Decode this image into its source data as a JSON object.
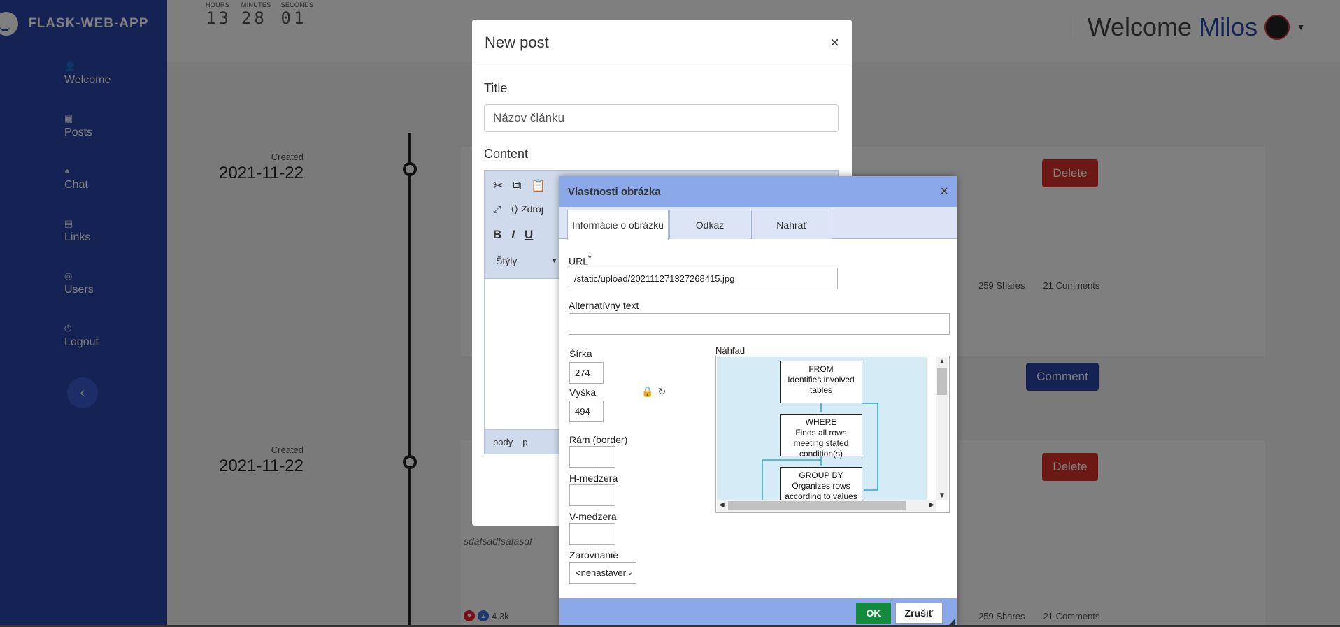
{
  "app": {
    "brand": "FLASK-WEB-APP"
  },
  "sidebar": {
    "items": [
      {
        "label": "Welcome",
        "icon": "user-icon"
      },
      {
        "label": "Posts",
        "icon": "posts-icon"
      },
      {
        "label": "Chat",
        "icon": "chat-icon"
      },
      {
        "label": "Links",
        "icon": "links-icon"
      },
      {
        "label": "Users",
        "icon": "users-icon"
      },
      {
        "label": "Logout",
        "icon": "logout-icon"
      }
    ]
  },
  "clock": {
    "hours_caption": "HOURS",
    "minutes_caption": "MINUTES",
    "seconds_caption": "SECONDS",
    "hours": "13",
    "minutes": "28",
    "seconds": "01"
  },
  "header": {
    "welcome": "Welcome",
    "user": "Milos"
  },
  "timeline": {
    "posts": [
      {
        "created_label": "Created",
        "date": "2021-11-22",
        "delete": "Delete",
        "shares": "259 Shares",
        "comments": "21 Comments",
        "comment_btn": "Comment"
      },
      {
        "created_label": "Created",
        "date": "2021-11-22",
        "delete": "Delete",
        "excerpt": "sdafsadfsafasdf",
        "likes": "4.3k",
        "shares": "259 Shares",
        "comments": "21 Comments"
      }
    ]
  },
  "new_post_modal": {
    "title": "New post",
    "title_label": "Title",
    "title_placeholder": "Názov článku",
    "content_label": "Content",
    "toolbar": {
      "source": "Zdroj",
      "bold": "B",
      "italic": "I",
      "underline": "U",
      "styles": "Štýly"
    },
    "path": {
      "body": "body",
      "p": "p"
    }
  },
  "image_dialog": {
    "title": "Vlastnosti obrázka",
    "tabs": [
      "Informácie o obrázku",
      "Odkaz",
      "Nahrať"
    ],
    "url_label": "URL",
    "url_required": "*",
    "url_value": "/static/upload/202111271327268415.jpg",
    "alt_label": "Alternatívny text",
    "alt_value": "",
    "width_label": "Šírka",
    "width_value": "274",
    "height_label": "Výška",
    "height_value": "494",
    "border_label": "Rám (border)",
    "hspace_label": "H-medzera",
    "vspace_label": "V-medzera",
    "align_label": "Zarovnanie",
    "align_value": "<nenastavené>",
    "preview_label": "Náhľad",
    "preview": {
      "boxes": [
        {
          "title": "FROM",
          "text": "Identifies involved tables"
        },
        {
          "title": "WHERE",
          "text": "Finds all rows meeting stated condition(s)"
        },
        {
          "title": "GROUP BY",
          "text": "Organizes rows according to values"
        }
      ]
    },
    "ok": "OK",
    "cancel": "Zrušiť"
  }
}
